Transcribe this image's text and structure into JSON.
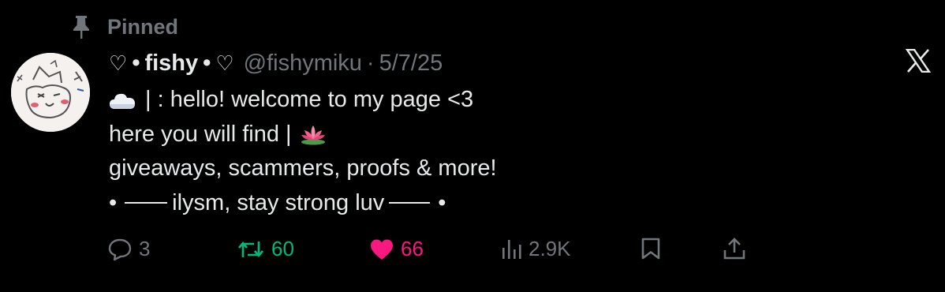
{
  "pinned": {
    "label": "Pinned"
  },
  "tweet": {
    "heart_left": "♡",
    "bullet_left": "•",
    "display_name": "fishy",
    "bullet_right": "•",
    "heart_right": "♡",
    "handle": "@fishymiku",
    "separator": "·",
    "date": "5/7/25",
    "lines": [
      "| : hello! welcome to my page <3",
      "here you will find |",
      "giveaways, scammers, proofs & more!",
      "ilysm, stay strong luv"
    ],
    "line4_left_bullet": "•",
    "line4_right_bullet": "•"
  },
  "actions": {
    "replies": "3",
    "retweets": "60",
    "likes": "66",
    "views": "2.9K"
  },
  "colors": {
    "background": "#000000",
    "text": "#e7e9ea",
    "muted": "#71767b",
    "retweet": "#00ba7c",
    "like": "#f91880"
  },
  "icons": [
    "pin-icon",
    "x-logo-icon",
    "cloud-emoji",
    "lotus-emoji",
    "reply-icon",
    "retweet-icon",
    "heart-filled-icon",
    "views-icon",
    "bookmark-icon",
    "share-icon"
  ]
}
